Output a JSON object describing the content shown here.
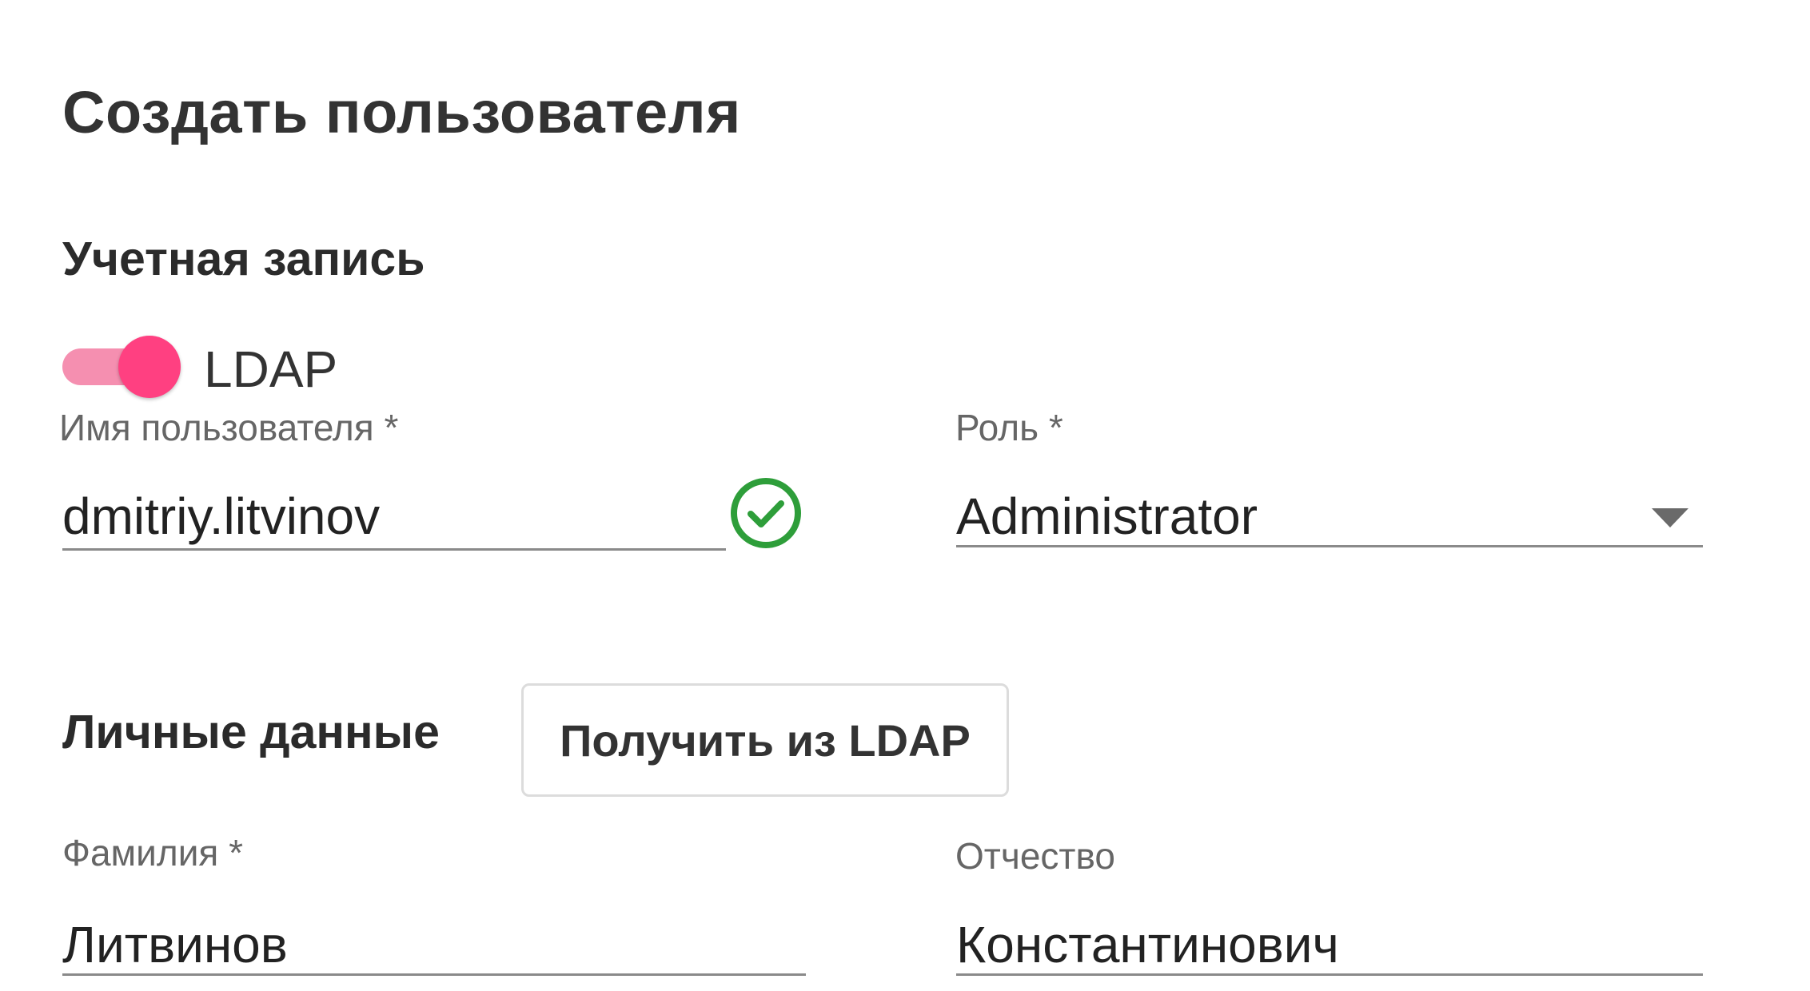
{
  "page": {
    "title": "Создать пользователя"
  },
  "account": {
    "section_title": "Учетная запись",
    "ldap_toggle": {
      "label": "LDAP",
      "enabled": true
    },
    "username": {
      "label": "Имя пользователя *",
      "value": "dmitriy.litvinov",
      "status_icon": "check-circle-icon"
    },
    "role": {
      "label": "Роль *",
      "value": "Administrator",
      "dropdown_icon": "chevron-down-icon"
    }
  },
  "personal": {
    "section_title": "Личные данные",
    "fetch_button_label": "Получить из LDAP",
    "last_name": {
      "label": "Фамилия *",
      "value": "Литвинов"
    },
    "patronymic": {
      "label": "Отчество",
      "value": "Константинович"
    }
  },
  "colors": {
    "accent": "#ff4081",
    "accent_track": "#f58fb0",
    "success": "#2e9e3a"
  }
}
